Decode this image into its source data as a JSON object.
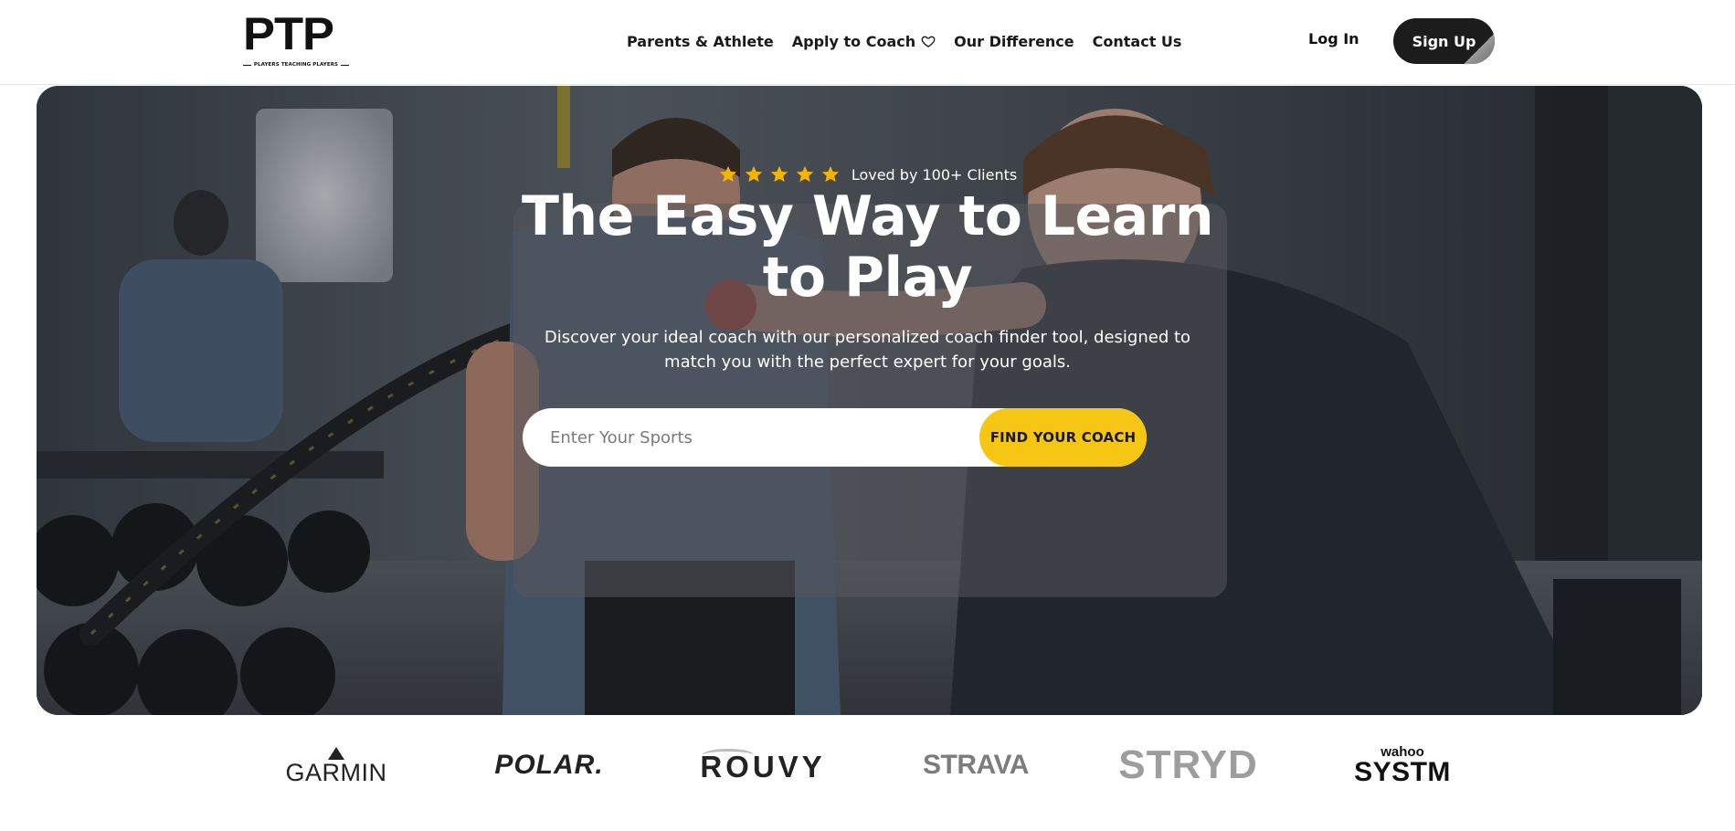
{
  "header": {
    "logo": {
      "word": "PTP",
      "tagline": "PLAYERS TEACHING PLAYERS"
    },
    "nav": [
      {
        "label": "Parents & Athlete"
      },
      {
        "label": "Apply to Coach",
        "icon": "heart-icon"
      },
      {
        "label": "Our Difference"
      },
      {
        "label": "Contact Us"
      }
    ],
    "login_label": "Log In",
    "signup_label": "Sign Up"
  },
  "hero": {
    "rating": {
      "stars": 5,
      "text": "Loved by 100+ Clients",
      "star_color": "#f4b400"
    },
    "headline_line1": "The Easy Way to Learn",
    "headline_line2": "to Play",
    "subtext_line1": "Discover your ideal coach with our personalized coach finder tool, designed to",
    "subtext_line2": "match you with the perfect expert for your goals.",
    "search": {
      "placeholder": "Enter Your Sports",
      "value": ""
    },
    "cta_label": "FIND YOUR COACH",
    "cta_color": "#f6c614"
  },
  "partners": [
    {
      "name": "GARMIN"
    },
    {
      "name": "POLAR."
    },
    {
      "name": "ROUVY"
    },
    {
      "name": "STRAVA"
    },
    {
      "name": "STRYD"
    },
    {
      "name_top": "wahoo",
      "name": "SYSTM"
    }
  ],
  "colors": {
    "brand_dark": "#1c1c1c",
    "accent_yellow": "#f6c614"
  }
}
